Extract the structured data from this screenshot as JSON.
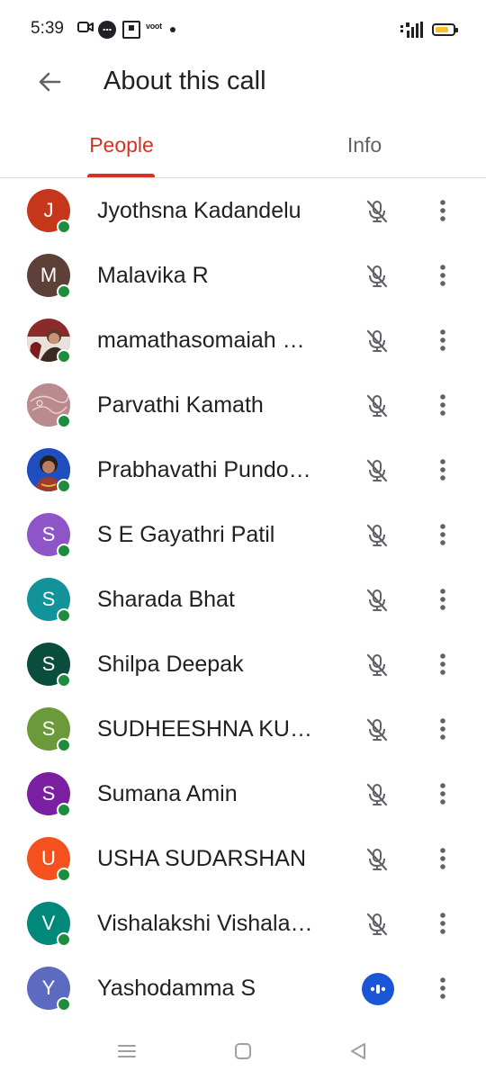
{
  "status_bar": {
    "time": "5:39",
    "app_label": "voot",
    "icons": [
      "video-icon",
      "chat-icon",
      "tv-icon",
      "signal-icon",
      "battery-icon"
    ],
    "battery_level": 0.75,
    "battery_color": "#f6c026"
  },
  "header": {
    "title": "About this call",
    "back_icon": "arrow-left-icon"
  },
  "tabs": [
    {
      "label": "People",
      "active": true
    },
    {
      "label": "Info",
      "active": false
    }
  ],
  "colors": {
    "accent": "#d93025",
    "online": "#1e8e3e",
    "speaking": "#1a56d6"
  },
  "people": [
    {
      "name": "Jyothsna Kadandelu",
      "initial": "J",
      "avatar_color": "#c5361a",
      "photo": null,
      "mic": "muted"
    },
    {
      "name": "Malavika R",
      "initial": "M",
      "avatar_color": "#5d4037",
      "photo": null,
      "mic": "muted"
    },
    {
      "name": "mamathasomaiah …",
      "initial": "",
      "avatar_color": "#8b2a2a",
      "photo": "portrait",
      "mic": "muted"
    },
    {
      "name": "Parvathi Kamath",
      "initial": "",
      "avatar_color": "#b98a8e",
      "photo": "pattern",
      "mic": "muted"
    },
    {
      "name": "Prabhavathi Pundo…",
      "initial": "",
      "avatar_color": "#1f4fbf",
      "photo": "portrait-blue",
      "mic": "muted"
    },
    {
      "name": "S E Gayathri Patil",
      "initial": "S",
      "avatar_color": "#8e55c9",
      "photo": null,
      "mic": "muted"
    },
    {
      "name": "Sharada Bhat",
      "initial": "S",
      "avatar_color": "#12939a",
      "photo": null,
      "mic": "muted"
    },
    {
      "name": "Shilpa Deepak",
      "initial": "S",
      "avatar_color": "#0b4d3c",
      "photo": null,
      "mic": "muted"
    },
    {
      "name": "SUDHEESHNA KU…",
      "initial": "S",
      "avatar_color": "#6a9a3a",
      "photo": null,
      "mic": "muted"
    },
    {
      "name": "Sumana Amin",
      "initial": "S",
      "avatar_color": "#7b1fa2",
      "photo": null,
      "mic": "muted"
    },
    {
      "name": "USHA SUDARSHAN",
      "initial": "U",
      "avatar_color": "#f4511e",
      "photo": null,
      "mic": "muted"
    },
    {
      "name": "Vishalakshi Vishala…",
      "initial": "V",
      "avatar_color": "#00897b",
      "photo": null,
      "mic": "muted"
    },
    {
      "name": "Yashodamma S",
      "initial": "Y",
      "avatar_color": "#5c6bc0",
      "photo": null,
      "mic": "speaking"
    }
  ],
  "nav_bar": {
    "buttons": [
      "menu-icon",
      "home-square-icon",
      "back-triangle-icon"
    ]
  }
}
